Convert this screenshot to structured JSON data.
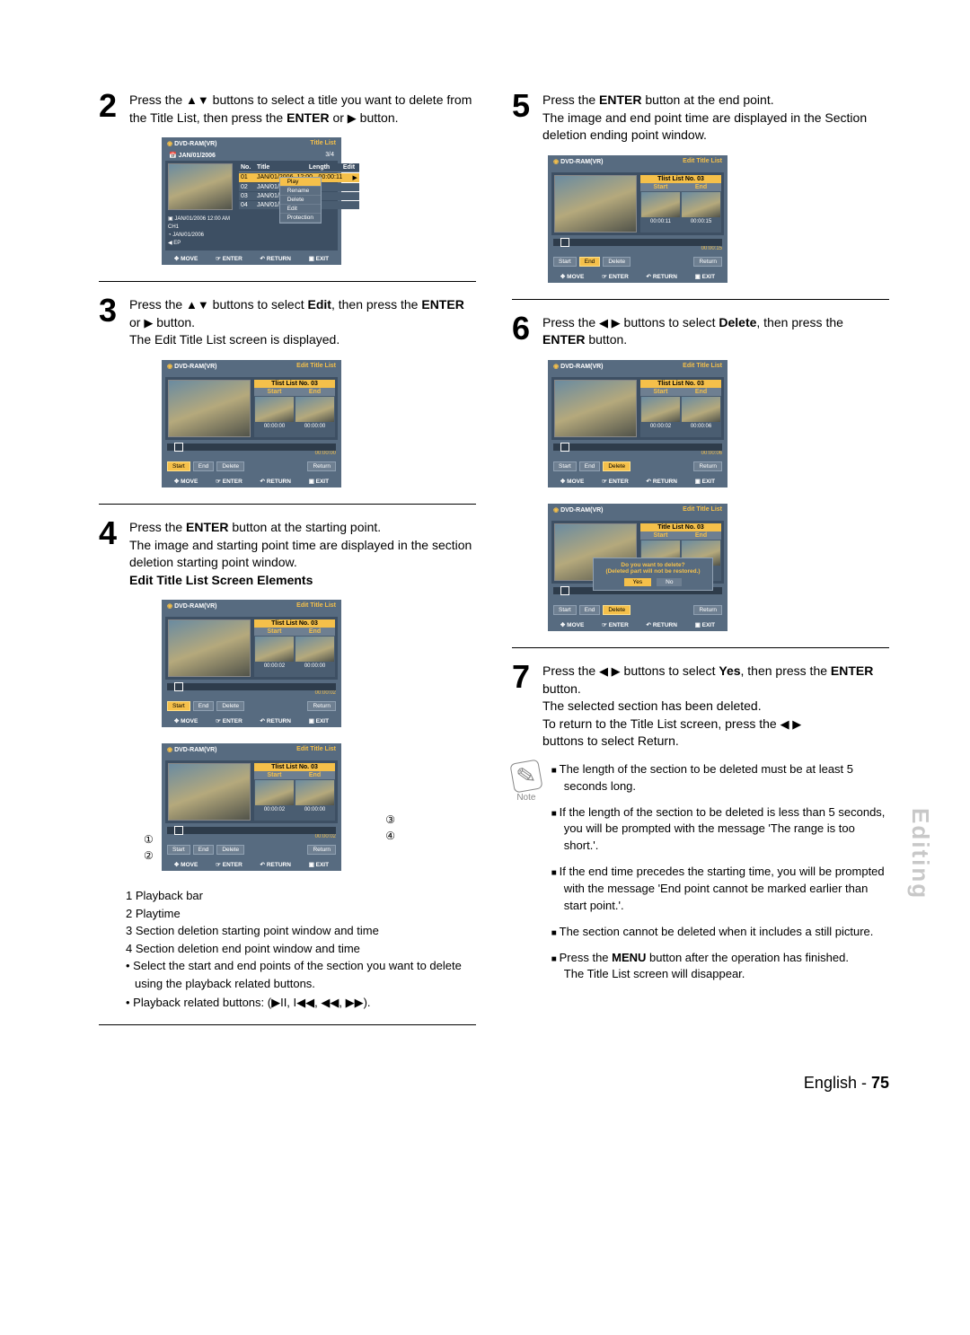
{
  "sidetab": "Editing",
  "footer": {
    "lang": "English -",
    "page": "75"
  },
  "steps": {
    "s2": {
      "num": "2",
      "text_a": "Press the ",
      "text_b": " buttons to select a title you want to delete from the Title List, then press the ",
      "text_c": " or ",
      "text_d": " button.",
      "enter": "ENTER"
    },
    "s3": {
      "num": "3",
      "text_a": "Press the ",
      "text_b": " buttons to select ",
      "edit": "Edit",
      "text_c": ", then press the ",
      "enter": "ENTER",
      "text_d": " or ",
      "text_e": " button.",
      "sub": "The Edit Title List screen is displayed."
    },
    "s4": {
      "num": "4",
      "text_a": "Press the ",
      "enter": "ENTER",
      "text_b": " button at the starting point.",
      "sub": "The image and starting point time are displayed in the section deletion starting point window.",
      "subtitle": "Edit Title List Screen Elements"
    },
    "s5": {
      "num": "5",
      "text_a": "Press the ",
      "enter": "ENTER",
      "text_b": " button at the end point.",
      "sub": "The image and end point time are displayed in the Section deletion ending point window."
    },
    "s6": {
      "num": "6",
      "text_a": "Press the ",
      "text_b": " buttons to select ",
      "del": "Delete",
      "text_c": ", then press the ",
      "enter": "ENTER",
      "text_d": " button."
    },
    "s7": {
      "num": "7",
      "text_a": "Press the ",
      "text_b": " buttons to select ",
      "yes": "Yes",
      "text_c": ", then press the ",
      "enter": "ENTER",
      "text_d": " button.",
      "sub1": "The selected section has been deleted.",
      "sub2": "To return to the Title List screen, press the ",
      "sub3": " buttons to select Return."
    }
  },
  "legend": {
    "l1": "Playback bar",
    "l2": "Playtime",
    "l3": "Section deletion starting point window and time",
    "l4": "Section deletion end point window and time",
    "b1": "Select the start and end points of the section you want to delete using the playback related buttons.",
    "b2": "Playback related buttons: (▶II, I◀◀, ◀◀, ▶▶)."
  },
  "note": {
    "label": "Note",
    "n1": "The length of the section to be deleted must be at least 5 seconds long.",
    "n2": "If the length of the section to be deleted is less than 5 seconds, you will be prompted with the message 'The range is too short.'.",
    "n3": "If the end time precedes the starting time, you will be prompted with the message 'End point cannot be marked earlier than start point.'.",
    "n4": "The section cannot be deleted when it includes a still picture.",
    "n5a": "Press the ",
    "menu": "MENU",
    "n5b": " button after the operation has finished.",
    "n5c": "The Title List screen will disappear."
  },
  "shot_common": {
    "disc": "DVD-RAM(VR)",
    "move": "MOVE",
    "enter": "ENTER",
    "return": "RETURN",
    "exit": "EXIT",
    "start_btn": "Start",
    "end_btn": "End",
    "delete_btn": "Delete",
    "return_btn": "Return",
    "start_hdr": "Start",
    "end_hdr": "End"
  },
  "shot2": {
    "title": "Title List",
    "date": "JAN/01/2006",
    "counter": "3/4",
    "cols": {
      "no": "No.",
      "title": "Title",
      "length": "Length",
      "edit": "Edit"
    },
    "rows": [
      {
        "no": "01",
        "title": "JAN/01/2006",
        "t": "12:00",
        "len": "00:00:11"
      },
      {
        "no": "02",
        "title": "JAN/01/2006",
        "t": "",
        "len": ""
      },
      {
        "no": "03",
        "title": "JAN/01/2006",
        "t": "",
        "len": ""
      },
      {
        "no": "04",
        "title": "JAN/01/2006",
        "t": "",
        "len": ""
      }
    ],
    "meta1": "JAN/01/2006 12:00 AM CH1",
    "meta2": "JAN/01/2006",
    "meta3": "EP",
    "menu": {
      "play": "Play",
      "rename": "Rename",
      "delete": "Delete",
      "edit": "Edit",
      "protection": "Protection"
    }
  },
  "shot3": {
    "title": "Edit Title List",
    "panel": "Tlist List No. 03",
    "t1": "00:00:00",
    "t2": "00:00:00",
    "pt": "00:00:00"
  },
  "shot4a": {
    "title": "Edit Title List",
    "panel": "Tlist List No. 03",
    "t1": "00:00:02",
    "t2": "00:00:00",
    "pt": "00:00:02"
  },
  "shot4b": {
    "title": "Edit Title List",
    "panel": "Tlist List No. 03",
    "t1": "00:00:02",
    "t2": "00:00:00",
    "pt": "00:00:02"
  },
  "shot5": {
    "title": "Edit Title List",
    "panel": "Tlist List No. 03",
    "t1": "00:00:11",
    "t2": "00:00:15",
    "pt": "00:00:15"
  },
  "shot6a": {
    "title": "Edit Title List",
    "panel": "Tlist List No. 03",
    "t1": "00:00:02",
    "t2": "00:00:06",
    "pt": "00:00:06"
  },
  "shot6b": {
    "title": "Edit Title List",
    "panel": "Title List No. 03",
    "msg1": "Do you want to delete?",
    "msg2": "(Deleted part will not be restored.)",
    "yes": "Yes",
    "no": "No"
  },
  "arrows": {
    "updown": "▲▼",
    "right": "▶",
    "leftright": "◀ ▶"
  },
  "callouts": {
    "c1": "①",
    "c2": "②",
    "c3": "③",
    "c4": "④"
  }
}
